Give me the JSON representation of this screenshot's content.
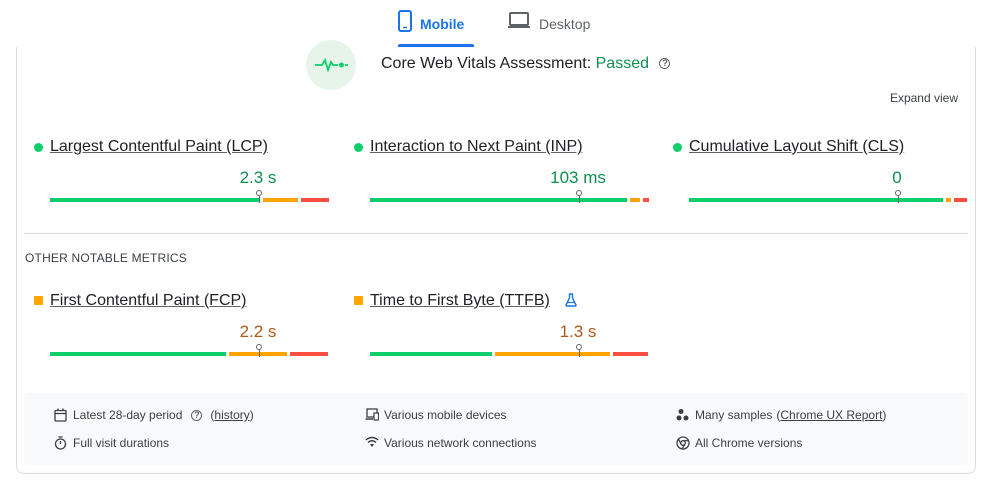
{
  "tabs": [
    {
      "label": "Mobile",
      "active": true,
      "icon": "smartphone-icon"
    },
    {
      "label": "Desktop",
      "active": false,
      "icon": "laptop-icon"
    }
  ],
  "assessment": {
    "title": "Core Web Vitals Assessment:",
    "status": "Passed",
    "status_color": "#0d904f",
    "help_glyph": "?",
    "expand_label": "Expand view"
  },
  "core_metrics": [
    {
      "name": "Largest Contentful Paint (LCP)",
      "value": "2.3 s",
      "rating": "good",
      "marker_fraction": 0.75,
      "bar": {
        "good": 0.765,
        "avg": 0.135,
        "poor": 0.1
      }
    },
    {
      "name": "Interaction to Next Paint (INP)",
      "value": "103 ms",
      "rating": "good",
      "marker_fraction": 0.75,
      "bar": {
        "good": 0.935,
        "avg": 0.045,
        "poor": 0.02
      }
    },
    {
      "name": "Cumulative Layout Shift (CLS)",
      "value": "0",
      "rating": "good",
      "marker_fraction": 0.75,
      "bar": {
        "good": 0.925,
        "avg": 0.03,
        "poor": 0.045
      }
    }
  ],
  "other_section_label": "OTHER NOTABLE METRICS",
  "other_metrics": [
    {
      "name": "First Contentful Paint (FCP)",
      "value": "2.2 s",
      "rating": "avg",
      "marker_fraction": 0.75,
      "bar": {
        "good": 0.645,
        "avg": 0.22,
        "poor": 0.135
      }
    },
    {
      "name": "Time to First Byte (TTFB)",
      "value": "1.3 s",
      "rating": "avg",
      "marker_fraction": 0.75,
      "experimental": true,
      "bar": {
        "good": 0.45,
        "avg": 0.425,
        "poor": 0.125
      }
    }
  ],
  "footer": {
    "period": "Latest 28-day period",
    "history_link": "history",
    "durations": "Full visit durations",
    "devices": "Various mobile devices",
    "network": "Various network connections",
    "samples_prefix": "Many samples",
    "samples_link": "Chrome UX Report",
    "chrome_versions": "All Chrome versions"
  },
  "colors": {
    "good": "#0cce6b",
    "average": "#ffa400",
    "poor": "#ff4e42",
    "accent": "#1a73e8"
  }
}
